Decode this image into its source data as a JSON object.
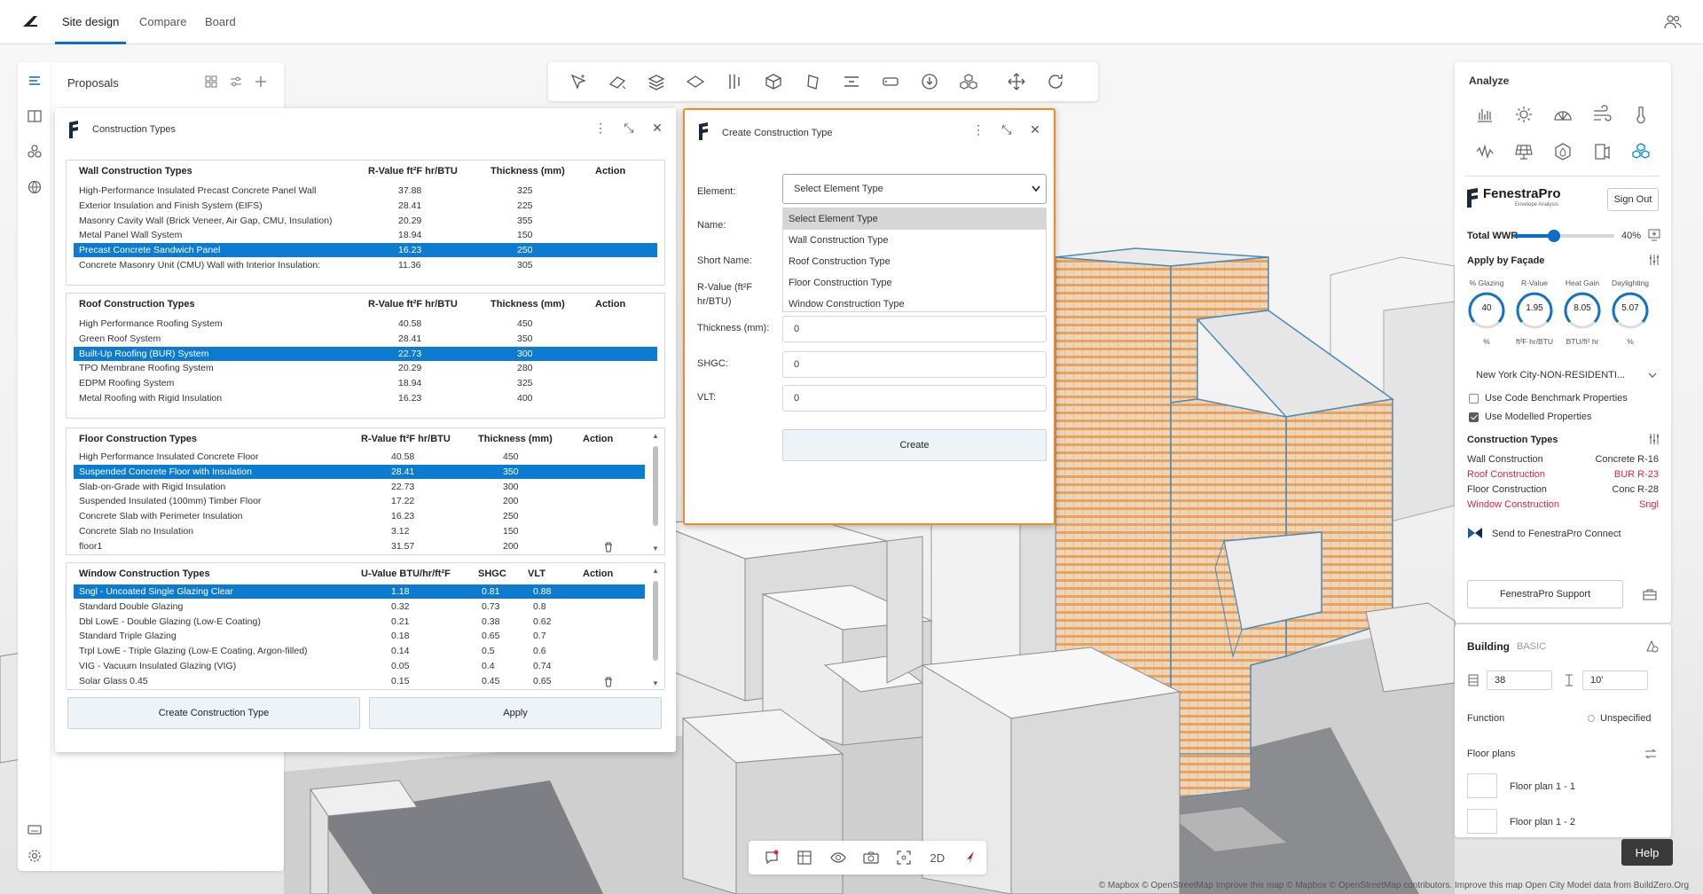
{
  "app": {
    "tabs": [
      {
        "label": "Site design",
        "active": true
      },
      {
        "label": "Compare",
        "active": false
      },
      {
        "label": "Board",
        "active": false
      }
    ]
  },
  "proposals": {
    "title": "Proposals"
  },
  "construction_types": {
    "title": "Construction Types",
    "wall": {
      "headers": [
        "Wall Construction Types",
        "R-Value ft²F hr/BTU",
        "Thickness (mm)",
        "Action"
      ],
      "rows": [
        [
          "High-Performance Insulated Precast Concrete Panel Wall",
          "37.88",
          "325"
        ],
        [
          "Exterior Insulation and Finish System (EIFS)",
          "28.41",
          "225"
        ],
        [
          "Masonry Cavity Wall (Brick Veneer, Air Gap, CMU, Insulation)",
          "20.29",
          "355"
        ],
        [
          "Metal Panel Wall System",
          "18.94",
          "150"
        ],
        [
          "Precast Concrete Sandwich Panel",
          "16.23",
          "250"
        ],
        [
          "Concrete Masonry Unit (CMU) Wall with Interior Insulation:",
          "11.36",
          "305"
        ]
      ],
      "selected": 4
    },
    "roof": {
      "headers": [
        "Roof Construction Types",
        "R-Value ft²F hr/BTU",
        "Thickness (mm)",
        "Action"
      ],
      "rows": [
        [
          "High Performance Roofing System",
          "40.58",
          "450"
        ],
        [
          "Green Roof System",
          "28.41",
          "350"
        ],
        [
          "Built-Up Roofing (BUR) System",
          "22.73",
          "300"
        ],
        [
          "TPO Membrane Roofing System",
          "20.29",
          "280"
        ],
        [
          "EDPM Roofing System",
          "18.94",
          "325"
        ],
        [
          "Metal Roofing with Rigid Insulation",
          "16.23",
          "400"
        ]
      ],
      "selected": 2
    },
    "floor": {
      "headers": [
        "Floor Construction Types",
        "R-Value ft²F hr/BTU",
        "Thickness (mm)",
        "Action"
      ],
      "rows": [
        [
          "High Performance Insulated Concrete Floor",
          "40.58",
          "450"
        ],
        [
          "Suspended Concrete Floor with Insulation",
          "28.41",
          "350"
        ],
        [
          "Slab-on-Grade with Rigid Insulation",
          "22.73",
          "300"
        ],
        [
          "Suspended Insulated (100mm) Timber Floor",
          "17.22",
          "200"
        ],
        [
          "Concrete Slab with Perimeter Insulation",
          "16.23",
          "250"
        ],
        [
          "Concrete Slab no Insulation",
          "3.12",
          "150"
        ],
        [
          "floor1",
          "31.57",
          "200"
        ]
      ],
      "selected": 1
    },
    "window": {
      "headers": [
        "Window Construction Types",
        "U-Value BTU/hr/ft²F",
        "SHGC",
        "VLT",
        "Action"
      ],
      "rows": [
        [
          "Sngl - Uncoated Single Glazing Clear",
          "1.18",
          "0.81",
          "0.88"
        ],
        [
          "Standard Double Glazing",
          "0.32",
          "0.73",
          "0.8"
        ],
        [
          "Dbl LowE - Double Glazing (Low-E Coating)",
          "0.21",
          "0.38",
          "0.62"
        ],
        [
          "Standard Triple Glazing",
          "0.18",
          "0.65",
          "0.7"
        ],
        [
          "Trpl LowE - Triple Glazing (Low-E Coating, Argon-filled)",
          "0.14",
          "0.5",
          "0.6"
        ],
        [
          "VIG - Vacuum Insulated Glazing (VIG)",
          "0.05",
          "0.4",
          "0.74"
        ],
        [
          "Solar Glass 0.45",
          "0.15",
          "0.45",
          "0.65"
        ]
      ],
      "selected": 0
    },
    "create_button": "Create Construction Type",
    "apply_button": "Apply"
  },
  "create_dialog": {
    "title": "Create Construction Type",
    "labels": {
      "element": "Element:",
      "name": "Name:",
      "short_name": "Short Name:",
      "rvalue": "R-Value (ft²F hr/BTU)",
      "thickness": "Thickness (mm):",
      "shgc": "SHGC:",
      "vlt": "VLT:"
    },
    "element_value": "Select Element Type",
    "dropdown_options": [
      "Select Element Type",
      "Wall Construction Type",
      "Roof Construction Type",
      "Floor Construction Type",
      "Window Construction Type"
    ],
    "thickness_value": "0",
    "shgc_value": "0",
    "vlt_value": "0",
    "create_button": "Create"
  },
  "analyze": {
    "title": "Analyze",
    "fenestra": {
      "name": "FenestraPro",
      "subtitle": "Envelope Analysis",
      "sign_out": "Sign Out"
    },
    "total_wwr": {
      "label": "Total WWR",
      "value": "40%",
      "fraction": 0.4
    },
    "apply_by_facade": "Apply by Façade",
    "gauges": [
      {
        "label": "% Glazing",
        "value": "40",
        "unit": "%"
      },
      {
        "label": "R-Value",
        "value": "1.95",
        "unit": "ft²F hr/BTU"
      },
      {
        "label": "Heat Gain",
        "value": "8.05",
        "unit": "BTU/ft² hr"
      },
      {
        "label": "Daylighting",
        "value": "5.07",
        "unit": "%"
      }
    ],
    "location": "New York City-NON-RESIDENTI...",
    "use_code_benchmark": "Use Code Benchmark Properties",
    "use_modelled": "Use Modelled Properties",
    "construction_types_title": "Construction Types",
    "construction_list": [
      {
        "label": "Wall Construction",
        "value": "Concrete R-16",
        "alert": false
      },
      {
        "label": "Roof Construction",
        "value": "BUR R-23",
        "alert": true
      },
      {
        "label": "Floor Construction",
        "value": "Conc R-28",
        "alert": false
      },
      {
        "label": "Window Construction",
        "value": "Sngl",
        "alert": true
      }
    ],
    "send_to": "Send to FenestraPro Connect",
    "support": "FenestraPro Support"
  },
  "building": {
    "title": "Building",
    "badge": "BASIC",
    "floors": "38",
    "floor_height": "10'",
    "function_label": "Function",
    "function_value": "Unspecified",
    "floor_plans_label": "Floor plans",
    "floor_plans": [
      "Floor plan 1 - 1",
      "Floor plan 1 - 2"
    ]
  },
  "help": "Help",
  "bottom_toolbar": {
    "mode_2d": "2D"
  },
  "attribution": "© Mapbox © OpenStreetMap Improve this map © Mapbox © OpenStreetMap contributors. Improve this map Open City Model data from BuildZero.Org"
}
